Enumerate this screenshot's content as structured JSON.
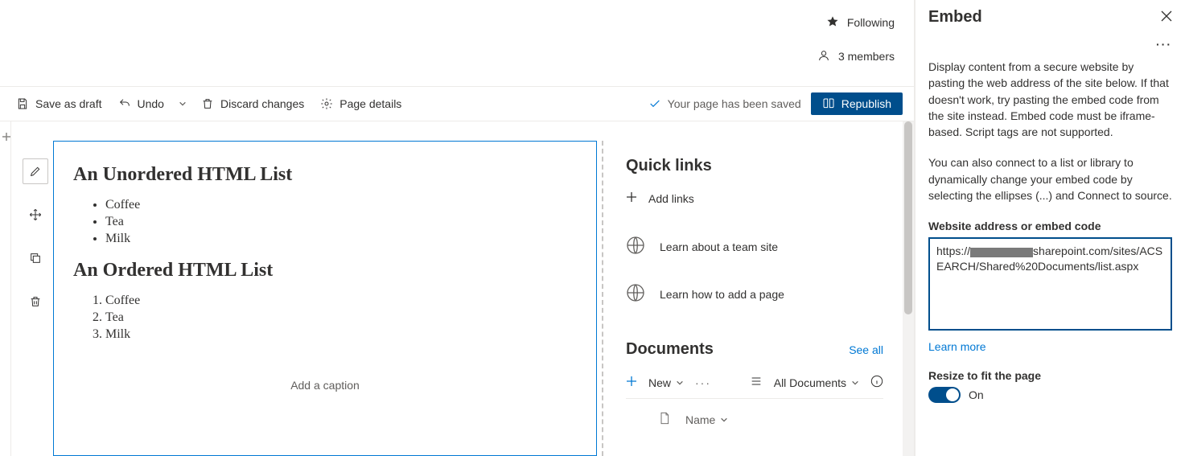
{
  "header": {
    "following_label": "Following",
    "members_label": "3 members"
  },
  "cmdbar": {
    "save_draft": "Save as draft",
    "undo": "Undo",
    "discard": "Discard changes",
    "page_details": "Page details",
    "saved_msg": "Your page has been saved",
    "republish": "Republish"
  },
  "webpart": {
    "h1": "An Unordered HTML List",
    "ul": [
      "Coffee",
      "Tea",
      "Milk"
    ],
    "h2": "An Ordered HTML List",
    "ol": [
      "Coffee",
      "Tea",
      "Milk"
    ],
    "caption_placeholder": "Add a caption"
  },
  "quicklinks": {
    "title": "Quick links",
    "add_label": "Add links",
    "items": [
      "Learn about a team site",
      "Learn how to add a page"
    ]
  },
  "documents": {
    "title": "Documents",
    "see_all": "See all",
    "new_label": "New",
    "view_label": "All Documents",
    "name_col": "Name"
  },
  "panel": {
    "title": "Embed",
    "help1": "Display content from a secure website by pasting the web address of the site below. If that doesn't work, try pasting the embed code from the site instead. Embed code must be iframe-based. Script tags are not supported.",
    "help2": "You can also connect to a list or library to dynamically change your embed code by selecting the ellipses (...) and Connect to source.",
    "field_label": "Website address or embed code",
    "input_prefix": "https://",
    "input_mid": "sharepoint.com",
    "input_suffix": "/sites/ACSEARCH/Shared%20Documents/list.aspx",
    "learn_more": "Learn more",
    "resize_label": "Resize to fit the page",
    "toggle_state": "On"
  }
}
